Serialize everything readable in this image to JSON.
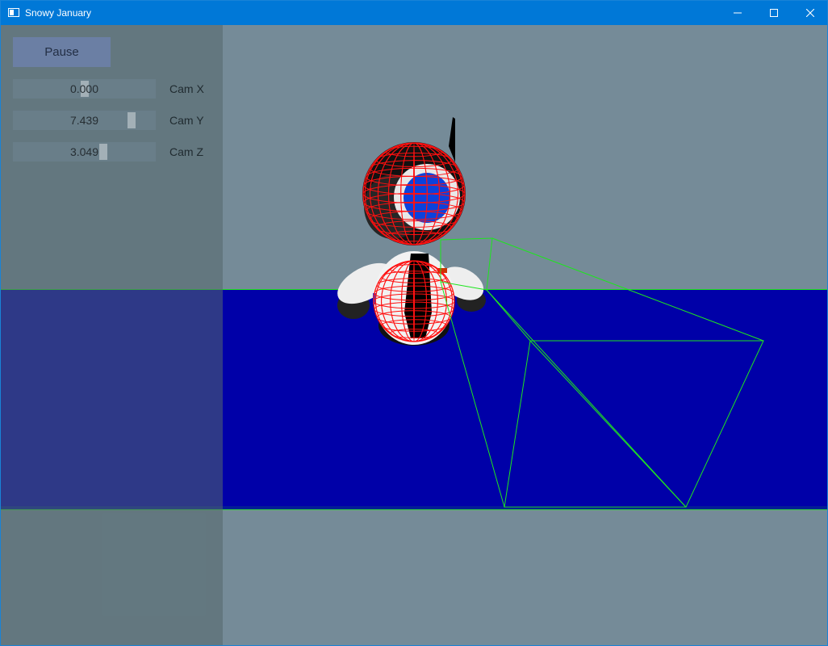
{
  "window": {
    "title": "Snowy January",
    "app_icon": "window-app-icon",
    "controls": [
      "minimize-icon",
      "maximize-icon",
      "close-icon"
    ]
  },
  "panel": {
    "pause_label": "Pause",
    "sliders": [
      {
        "label": "Cam X",
        "value": "0.000",
        "fraction": 0.5
      },
      {
        "label": "Cam Y",
        "value": "7.439",
        "fraction": 0.85
      },
      {
        "label": "Cam Z",
        "value": "3.049",
        "fraction": 0.64
      }
    ]
  },
  "scene": {
    "sky_color": "#758b98",
    "ground_color": "#0000a8",
    "wireframe_green": "#1ee51e",
    "wireframe_red": "#ff1010",
    "eye_color": "#0b41dd"
  }
}
